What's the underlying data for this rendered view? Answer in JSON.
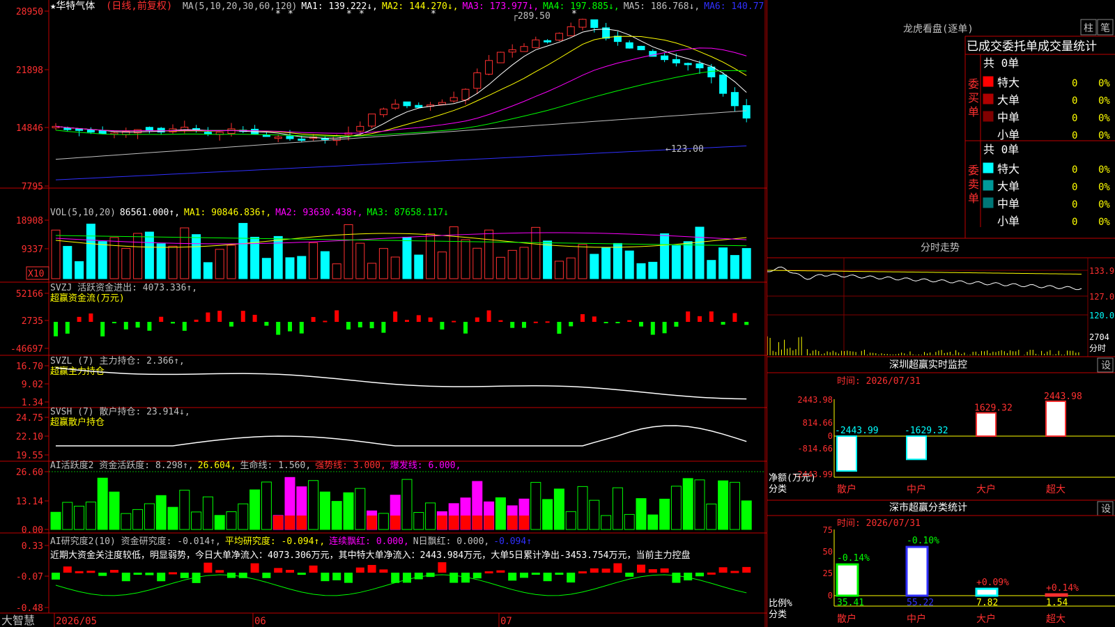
{
  "stock": {
    "star": "★",
    "name": "华特气体",
    "mode": "(日线,前复权)"
  },
  "ma_legend": [
    {
      "label": "MA(5,10,20,30,60,120)",
      "color": "#c0c0c0"
    },
    {
      "label": "MA1: 139.222↓,",
      "color": "#ffffff"
    },
    {
      "label": "MA2: 144.270↓,",
      "color": "#ffff00"
    },
    {
      "label": "MA3: 173.977↓,",
      "color": "#ff00ff"
    },
    {
      "label": "MA4: 197.885↓,",
      "color": "#00ff00"
    },
    {
      "label": "MA5: 186.768↓,",
      "color": "#c0c0c0"
    },
    {
      "label": "MA6: 140.77",
      "color": "#3030ff"
    }
  ],
  "price_axis": [
    "28950",
    "21898",
    "14846",
    "7795"
  ],
  "high_label": "289.50",
  "low_label": "←123.00",
  "vol_legend": [
    {
      "label": "VOL(5,10,20)",
      "color": "#c0c0c0"
    },
    {
      "label": "86561.000↑,",
      "color": "#ffffff"
    },
    {
      "label": "MA1: 90846.836↑,",
      "color": "#ffff00"
    },
    {
      "label": "MA2: 93630.438↑,",
      "color": "#ff00ff"
    },
    {
      "label": "MA3: 87658.117↓",
      "color": "#00ff00"
    }
  ],
  "vol_axis": [
    "18908",
    "9337"
  ],
  "vol_unit": "X10",
  "svzj": {
    "legend1": "SVZJ  活跃资金进出: 4073.336↑,",
    "legend2": "超赢资金流(万元)",
    "axis": [
      "52166",
      "2735",
      "-46697"
    ]
  },
  "svzl": {
    "legend1": "SVZL (7) 主力持仓: 2.366↑,",
    "legend2": "超赢主力持仓",
    "axis": [
      "16.70",
      "9.02",
      "1.34"
    ]
  },
  "svsh": {
    "legend1": "SVSH (7) 散户持仓: 23.914↓,",
    "legend2": "超赢散户持仓",
    "axis": [
      "24.75",
      "22.10",
      "19.55"
    ]
  },
  "ai1": {
    "legend": [
      {
        "label": "AI活跃度2 资金活跃度: 8.298↑,",
        "color": "#c0c0c0"
      },
      {
        "label": "26.604,",
        "color": "#ffff00"
      },
      {
        "label": "生命线: 1.560,",
        "color": "#c0c0c0"
      },
      {
        "label": "强势线: 3.000,",
        "color": "#ff3030"
      },
      {
        "label": "爆发线: 6.000,",
        "color": "#ff00ff"
      }
    ],
    "axis": [
      "26.60",
      "13.14",
      "0.00"
    ]
  },
  "ai2": {
    "legend": [
      {
        "label": "AI研究度2(10) 资金研究度: -0.014↑,",
        "color": "#c0c0c0"
      },
      {
        "label": "平均研究度: -0.094↑,",
        "color": "#ffff00"
      },
      {
        "label": "连续飘红: 0.000,",
        "color": "#ff00ff"
      },
      {
        "label": "N日飘红: 0.000,",
        "color": "#c0c0c0"
      },
      {
        "label": "-0.094↑",
        "color": "#3030ff"
      }
    ],
    "comment": "近期大资金关注度较低，明显弱势，今日大单净流入：4073.306万元，其中特大单净流入：2443.984万元，大单5日累计净出-3453.754万元，当前主力控盘",
    "axis": [
      "0.33",
      "-0.07",
      "-0.48"
    ]
  },
  "dates": [
    "2026/05",
    "06",
    "07"
  ],
  "brand": "大智慧",
  "dragon": {
    "title": "龙虎看盘(逐单)",
    "btn1": "柱",
    "btn2": "笔",
    "tabs": "已成交委托单成交量统计",
    "buy_label": "委买单",
    "sell_label": "委卖单",
    "total": "共 0单",
    "rows": [
      "特大",
      "大单",
      "中单",
      "小单"
    ],
    "zero": "0",
    "pct": "0%"
  },
  "intraday": {
    "title": "分时走势",
    "prices": [
      "133.9",
      "127.0",
      "120.0"
    ],
    "vol": "2704",
    "unit": "分时"
  },
  "sz_monitor": {
    "title": "深圳超赢实时监控",
    "btn": "设",
    "date": "时间: 2026/07/31",
    "axis": [
      "2443.98",
      "814.66",
      "0",
      "-814.66",
      "-2443.99"
    ],
    "ylabel": "净额(万元)",
    "xlabel": "分类",
    "cats": [
      "散户",
      "中户",
      "大户",
      "超大"
    ],
    "labels": [
      "-2443.99",
      "-1629.32",
      "1629.32",
      "2443.98"
    ]
  },
  "sz_class": {
    "title": "深市超赢分类统计",
    "btn": "设",
    "date": "时间: 2026/07/31",
    "axis": [
      "75",
      "50",
      "25",
      "0"
    ],
    "ylabel": "比例%",
    "xlabel": "分类",
    "cats": [
      "散户",
      "中户",
      "大户",
      "超大"
    ],
    "chg": [
      "-0.14%",
      "-0.10%",
      "+0.09%",
      "+0.14%"
    ],
    "pct": [
      "35.41",
      "55.22",
      "7.82",
      "1.54"
    ]
  },
  "chart_data": [
    {
      "type": "bar",
      "title": "深圳超赢实时监控",
      "categories": [
        "散户",
        "中户",
        "大户",
        "超大"
      ],
      "values": [
        -2443.99,
        -1629.32,
        1629.32,
        2443.98
      ],
      "ylabel": "净额(万元)",
      "xlabel": "分类",
      "ylim": [
        -2443.99,
        2443.98
      ]
    },
    {
      "type": "bar",
      "title": "深市超赢分类统计",
      "categories": [
        "散户",
        "中户",
        "大户",
        "超大"
      ],
      "values": [
        35.41,
        55.22,
        7.82,
        1.54
      ],
      "ylabel": "比例%",
      "xlabel": "分类",
      "ylim": [
        0,
        75
      ]
    }
  ]
}
